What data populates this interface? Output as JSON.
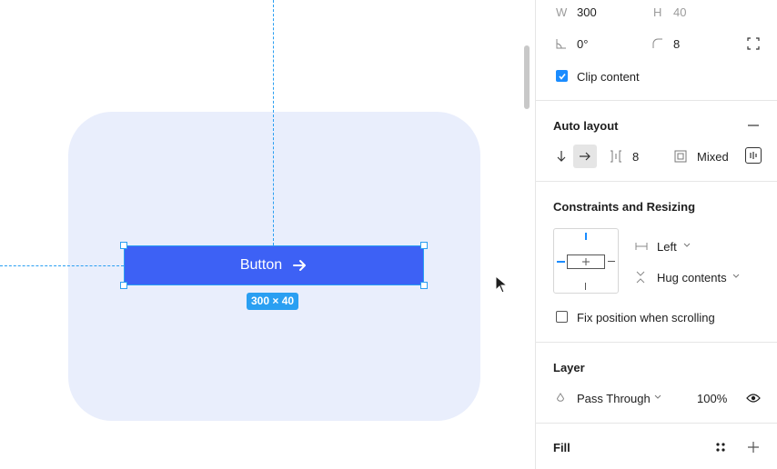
{
  "canvas": {
    "button_label": "Button",
    "size_badge": "300 × 40",
    "frame_color": "#e9eefc",
    "button_color": "#3d61f5",
    "selection_color": "#2a9ff2"
  },
  "panel": {
    "dimensions": {
      "w_label": "W",
      "w_value": "300",
      "h_label": "H",
      "h_value": "40",
      "rotation_value": "0°",
      "radius_value": "8"
    },
    "clip_content": {
      "label": "Clip content",
      "checked": true
    },
    "auto_layout": {
      "title": "Auto layout",
      "spacing_value": "8",
      "padding_value": "Mixed"
    },
    "constraints": {
      "title": "Constraints and Resizing",
      "horizontal_value": "Left",
      "vertical_value": "Hug contents",
      "fix_position_label": "Fix position when scrolling",
      "fix_position_checked": false
    },
    "layer": {
      "title": "Layer",
      "blend_mode": "Pass Through",
      "opacity": "100%"
    },
    "fill": {
      "title": "Fill"
    }
  }
}
